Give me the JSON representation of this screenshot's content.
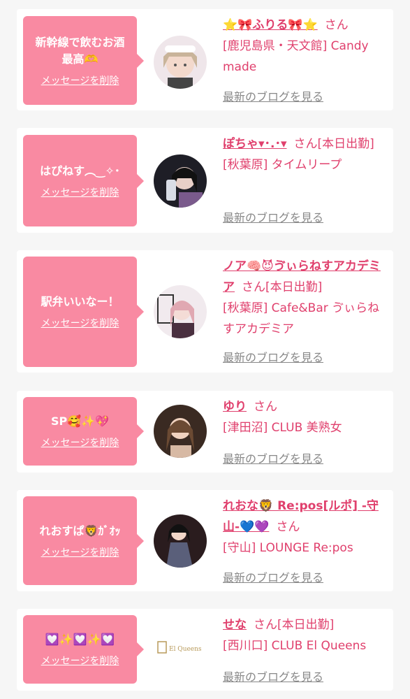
{
  "delete_label": "メッセージを削除",
  "blog_label": "最新のブログを見る",
  "san_label": "さん",
  "items": [
    {
      "message": "新幹線で飲むお酒最高🫶",
      "name": "⭐🎀ふりる🎀⭐",
      "suffix": "",
      "shop": "[鹿児島県・天文館] Candy made",
      "avatar_icon": "maid-girl-avatar"
    },
    {
      "message": "はぴねす︵‿✧･",
      "name": "ぽちゃ▾･.･▾",
      "suffix": "[本日出勤]",
      "shop": "[秋葉原] タイムリープ",
      "avatar_icon": "dark-girl-avatar"
    },
    {
      "message": "駅弁いいなー！",
      "name": "ノア🧠😈ゔぃらねすアカデミア",
      "suffix": "[本日出勤]",
      "shop": "[秋葉原] Cafe&Bar ゔぃらねすアカデミア",
      "avatar_icon": "pink-girl-avatar"
    },
    {
      "message": "SP🥰✨💖",
      "name": "ゆり",
      "suffix": "",
      "shop": "[津田沼] CLUB 美熟女",
      "avatar_icon": "woman-avatar"
    },
    {
      "message": "れおすぱ🦁ｶﾞｵｯ",
      "name": "れおな🦁 Re:pos[ルポ] -守山-💙💜",
      "suffix": "",
      "shop": "[守山] LOUNGE Re:pos",
      "avatar_icon": "dress-woman-avatar"
    },
    {
      "message": "💟✨💟✨💟",
      "name": "せな",
      "suffix": "[本日出勤]",
      "shop": "[西川口] CLUB El Queens",
      "avatar_icon": "club-logo-avatar",
      "logo_text": "El Queens"
    }
  ]
}
